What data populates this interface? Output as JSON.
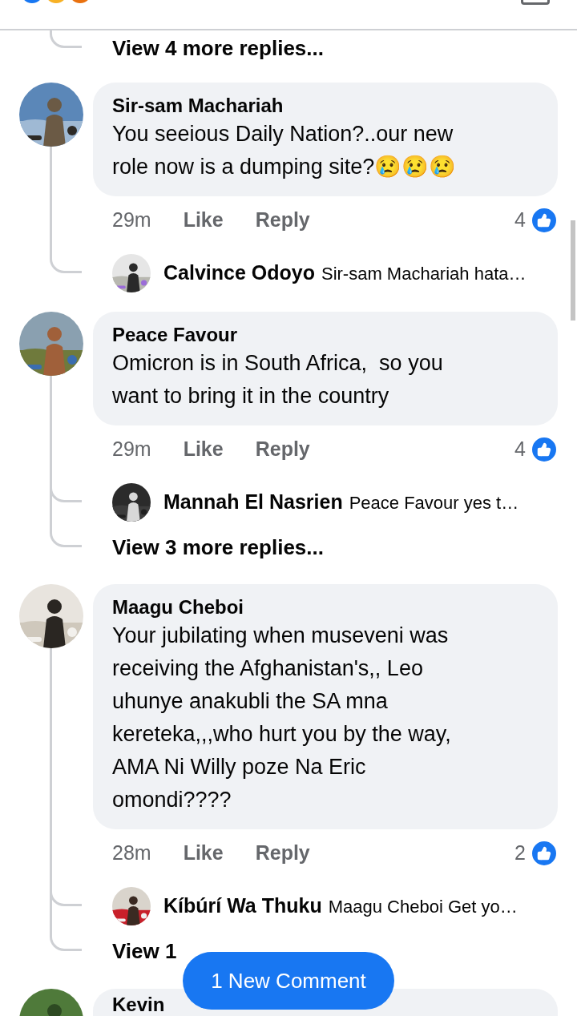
{
  "threads": [
    {
      "kind": "tail",
      "view_more": "View 4 more replies..."
    },
    {
      "kind": "comment",
      "name": "Sir-sam Machariah",
      "text": "You seeious Daily Nation?..our new role now is a dumping site?😢😢😢",
      "time": "29m",
      "like": "Like",
      "reply": "Reply",
      "like_count": "4",
      "replies": [
        {
          "name": "Calvince Odoyo",
          "text": "Sir-sam Machariah hata…"
        }
      ]
    },
    {
      "kind": "comment",
      "name": "Peace Favour",
      "text": "Omicron is in South Africa,  so you want to bring it in the country",
      "time": "29m",
      "like": "Like",
      "reply": "Reply",
      "like_count": "4",
      "replies": [
        {
          "name": "Mannah El Nasrien",
          "text": "Peace Favour yes t…"
        }
      ],
      "view_more": "View 3 more replies..."
    },
    {
      "kind": "comment",
      "name": "Maagu Cheboi",
      "text": "Your jubilating when museveni was receiving the Afghanistan's,, Leo uhunye anakubli the SA mna kereteka,,,who hurt you by the way, AMA Ni Willy poze Na Eric omondi????",
      "time": "28m",
      "like": "Like",
      "reply": "Reply",
      "like_count": "2",
      "replies": [
        {
          "name": "Kíbúrí Wa Thuku",
          "text": "Maagu Cheboi Get yo…"
        }
      ],
      "view_more": "View 1"
    },
    {
      "kind": "cut",
      "name": "Kevin"
    }
  ],
  "new_comment_button": "1 New Comment"
}
